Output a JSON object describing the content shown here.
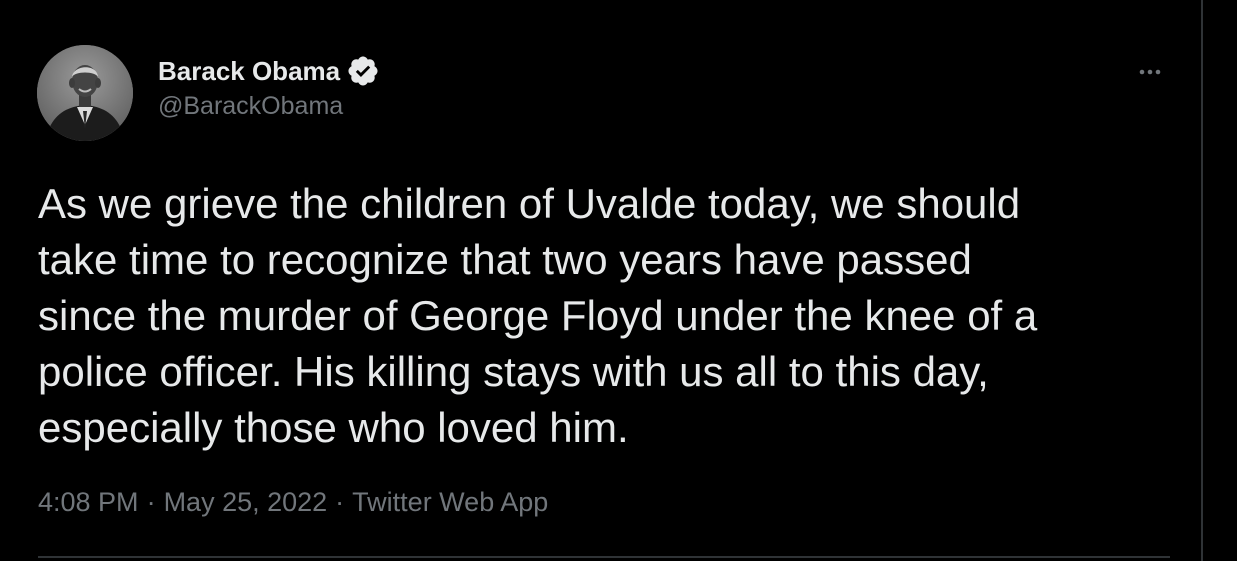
{
  "author": {
    "display_name": "Barack Obama",
    "handle": "@BarackObama",
    "verified": true,
    "verified_color": "#e7e9ea",
    "avatar_icon": "profile-photo"
  },
  "more_icon": "more-horizontal-icon",
  "tweet": {
    "text": "As we grieve the children of Uvalde today, we should\ntake time to recognize that two years have passed\nsince the murder of George Floyd under the knee of a\npolice officer. His killing stays with us all to this day,\nespecially those who loved him."
  },
  "meta": {
    "time": "4:08 PM",
    "separator": "·",
    "date": "May 25, 2022",
    "source": "Twitter Web App"
  },
  "colors": {
    "background": "#000000",
    "text_primary": "#e7e9ea",
    "text_secondary": "#71767b",
    "border": "#2f3336"
  }
}
